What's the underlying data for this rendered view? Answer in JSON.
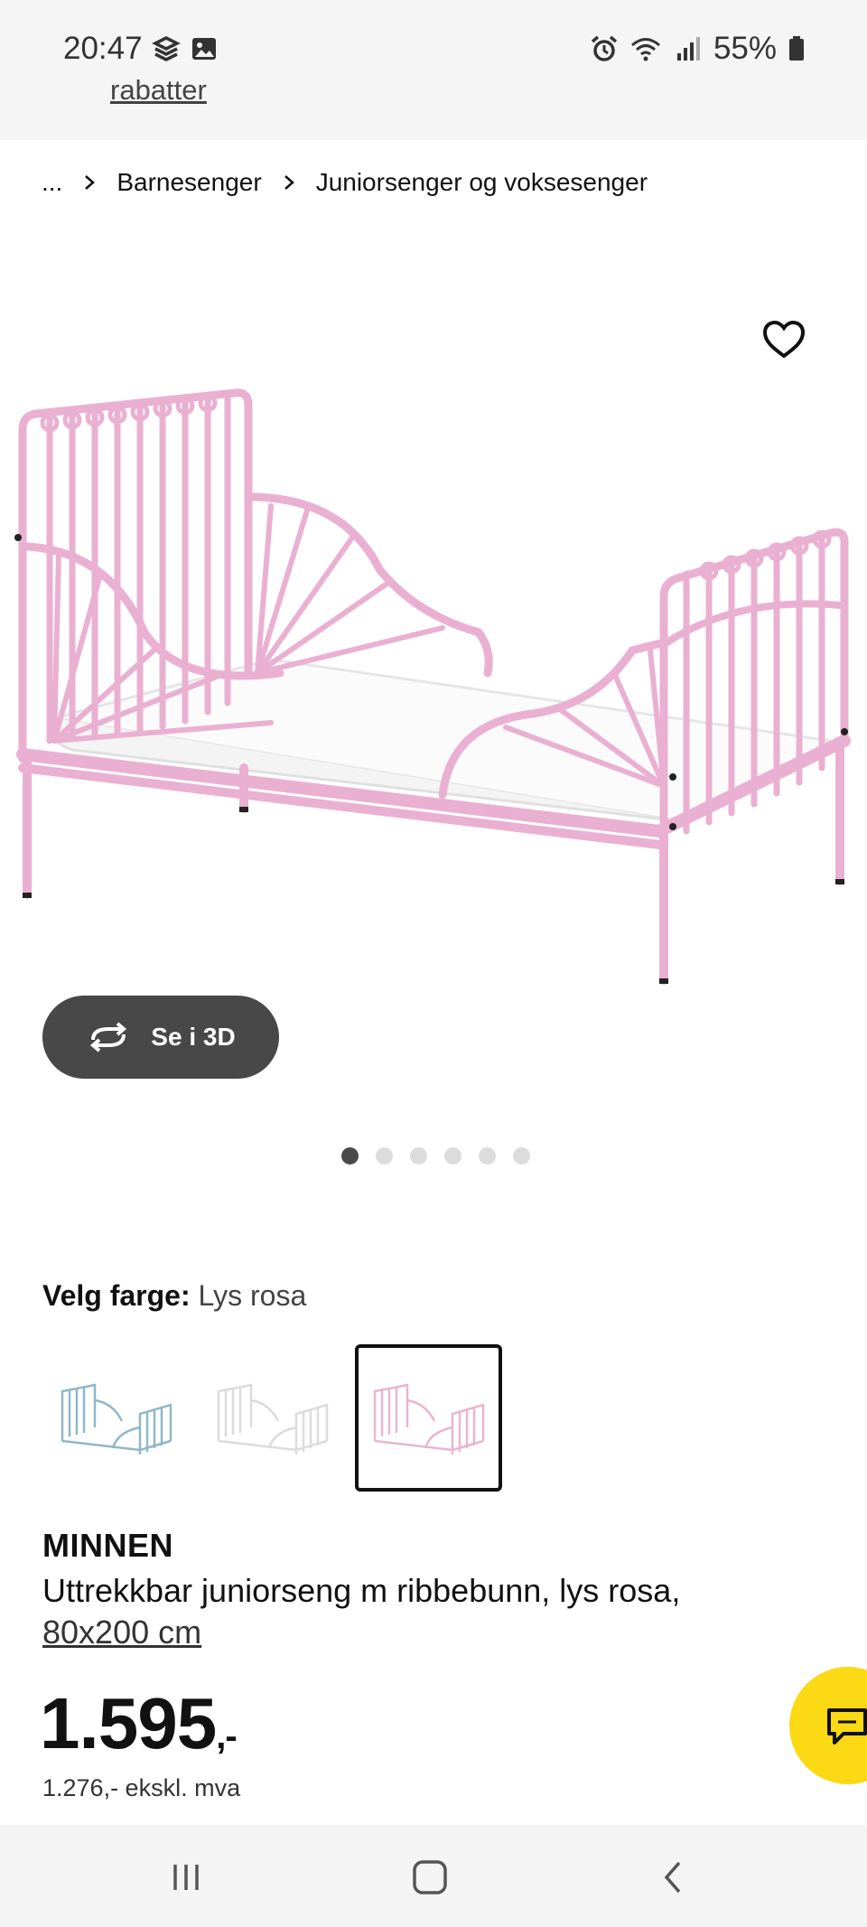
{
  "status_bar": {
    "time": "20:47",
    "battery": "55%",
    "left_icons": [
      "app-icon",
      "gallery-icon"
    ],
    "right_icons": [
      "alarm-icon",
      "wifi-icon",
      "signal-icon",
      "battery-icon"
    ]
  },
  "top_link": "rabatter",
  "breadcrumb": {
    "ellipsis": "...",
    "items": [
      "Barnesenger",
      "Juniorsenger og voksesenger"
    ]
  },
  "gallery": {
    "view_3d_label": "Se i 3D",
    "dot_count": 6,
    "active_dot": 0
  },
  "color_selector": {
    "label": "Velg farge:",
    "selected": "Lys rosa",
    "swatches": [
      {
        "color": "#8fb8c9"
      },
      {
        "color": "#e4e4e4"
      },
      {
        "color": "#e8b6cf"
      }
    ],
    "selected_index": 2
  },
  "product": {
    "name": "MINNEN",
    "description": "Uttrekkbar juniorseng m ribbebunn, lys rosa,",
    "size": "80x200 cm",
    "price_main": "1.595",
    "price_suffix": ",-",
    "price_ex_vat": "1.276,- ekskl. mva"
  },
  "colors": {
    "bed_pink": "#eab0d2",
    "chat_fab": "#fbd914",
    "button_dark": "#484848"
  }
}
